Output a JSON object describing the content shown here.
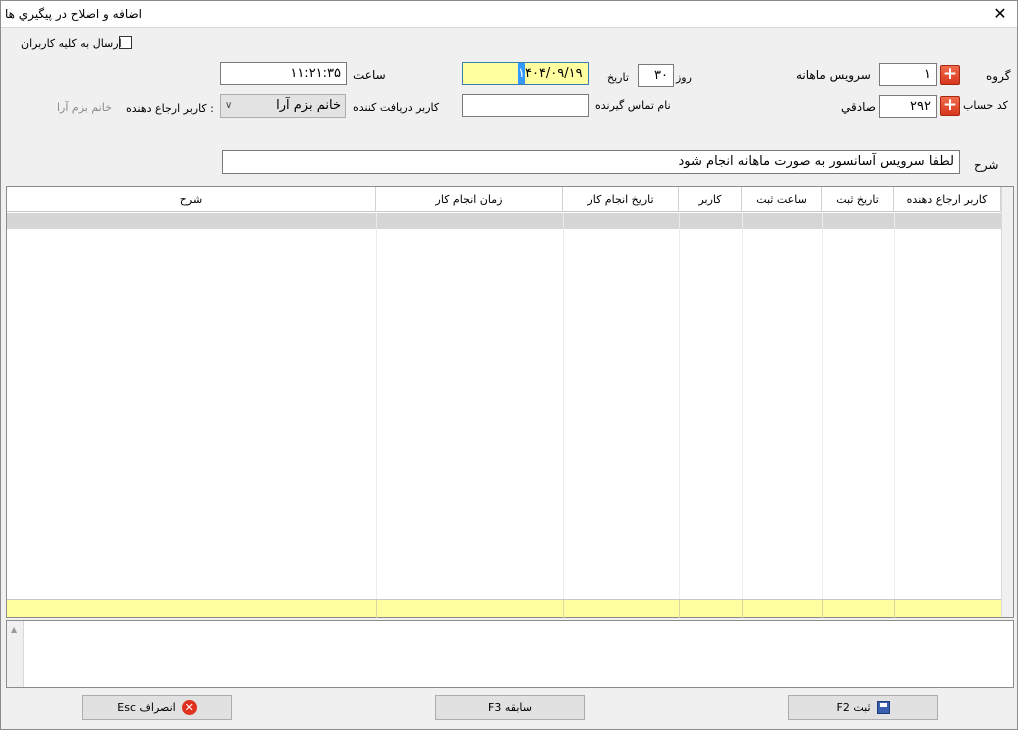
{
  "window": {
    "title": "اضافه و اصلاح در پيگيري ها",
    "close_glyph": "✕"
  },
  "form": {
    "send_all_label": "ارسال به کليه کاربران",
    "group_label": "گروه",
    "group_value": "۱",
    "group_name": "سرويس ماهانه",
    "account_label": "کد حساب",
    "account_value": "۲۹۲",
    "account_name": "صادقي",
    "day_label": "روز",
    "day_value": "۳۰",
    "date_label": "تاريخ",
    "date_value_selected": "۱",
    "date_value_rest": "۴۰۴/۰۹/۱۹",
    "time_label": "ساعت",
    "time_value": "۱۱:۲۱:۳۵",
    "contact_label": "نام تماس گيرنده",
    "contact_value": "",
    "receiver_label": "کاربر دريافت کننده",
    "receiver_value": "خانم بزم آرا",
    "referrer_label": "کاربر ارجاع دهنده :",
    "referrer_value": "خانم بزم آرا",
    "desc_label": "شرح",
    "desc_value": "لطفا سرويس آسانسور به صورت ماهانه انجام شود",
    "plus_glyph": "+",
    "dropdown_glyph": "∨"
  },
  "grid": {
    "columns": [
      "کاربر ارجاع دهنده",
      "تاريخ ثبت",
      "ساعت ثبت",
      "کاربر",
      "تاريخ انجام کار",
      "زمان انجام کار",
      "شرح"
    ]
  },
  "memo": {
    "value": ""
  },
  "buttons": {
    "save_label": "ثبت F2",
    "history_label": "سابقه F3",
    "cancel_label": "انصراف Esc",
    "cancel_glyph": "✕"
  },
  "colors": {
    "highlight_yellow": "#ffff9f",
    "selection_blue": "#3399ff",
    "plus_red": "#e04a2c"
  }
}
